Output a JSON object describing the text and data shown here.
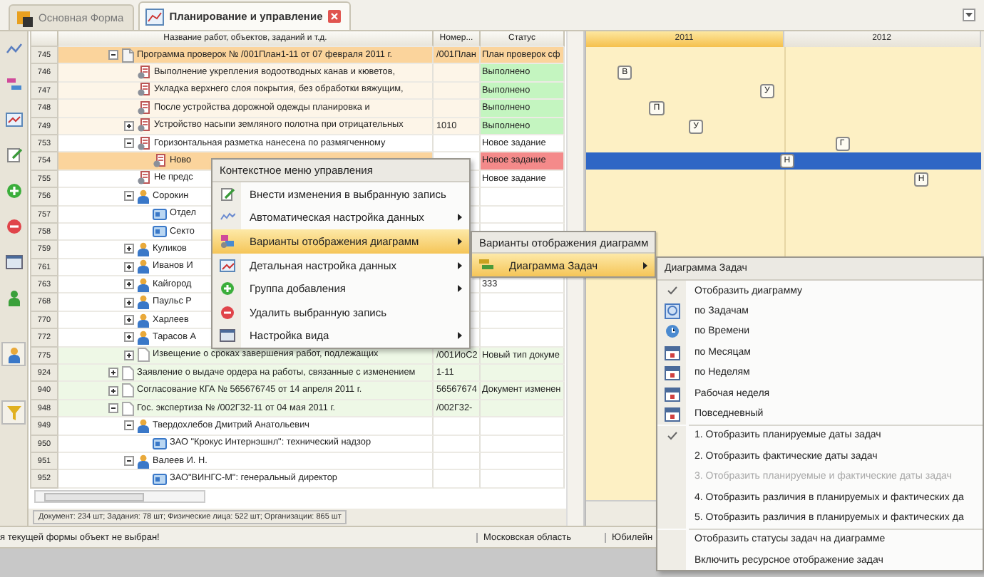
{
  "tabs": [
    {
      "label": "Основная Форма",
      "selected": false,
      "closable": false
    },
    {
      "label": "Планирование и управление",
      "selected": true,
      "closable": true
    }
  ],
  "grid": {
    "columns": [
      "Название работ, объектов, заданий и т.д.",
      "Номер...",
      "Статус"
    ],
    "rows": [
      {
        "row_number": "745",
        "kind": "program",
        "text": "Программа проверок № /001План1-11 от 07 февраля 2011 г.",
        "number": "/001План",
        "status": {
          "text": "План проверок сф",
          "color": "#fbd49c"
        },
        "color": "#fbd49c",
        "selected": false,
        "expanded": true,
        "children": [
          {
            "row_number": "746",
            "kind": "task",
            "text": "Выполнение укрепления водоотводных канав и кюветов,",
            "status": {
              "text": "Выполнено",
              "color": "#c4f5c0"
            },
            "color": "#fdf5e8",
            "selected": false,
            "gantt_label": "В"
          },
          {
            "row_number": "747",
            "kind": "task",
            "text": "Укладка верхнего слоя покрытия, без обработки вяжущим,",
            "status": {
              "text": "Выполнено",
              "color": "#c4f5c0"
            },
            "color": "#fdf5e8",
            "selected": false,
            "gantt_label": "У"
          },
          {
            "row_number": "748",
            "kind": "task",
            "text": "После устройства дорожной одежды планировка и",
            "status": {
              "text": "Выполнено",
              "color": "#c4f5c0"
            },
            "color": "#fdf5e8",
            "selected": false,
            "gantt_label": "П"
          },
          {
            "row_number": "749",
            "kind": "task",
            "text": "Устройство насыпи земляного полотна при отрицательных",
            "number": "1010",
            "status": {
              "text": "Выполнено",
              "color": "#c4f5c0"
            },
            "color": "#fdf5e8",
            "selected": false,
            "expanded": false,
            "gantt_label": "У"
          },
          {
            "row_number": "753",
            "kind": "task",
            "text": "Горизонтальная разметка нанесена по размягченному",
            "status": {
              "text": "Новое задание",
              "color": "#ffffff"
            },
            "color": "#ffffff",
            "selected": false,
            "expanded": true,
            "gantt_label": "Г",
            "children": [
              {
                "row_number": "754",
                "kind": "task",
                "text": "Ново",
                "status": {
                  "text": "Новое задание",
                  "color": "#f48a8a"
                },
                "color": "#ffffff",
                "selected": true,
                "gantt_label": "Н"
              }
            ]
          },
          {
            "row_number": "755",
            "kind": "task",
            "text": "Не предс",
            "status": {
              "text": "Новое задание",
              "color": "#ffffff"
            },
            "color": "#ffffff",
            "selected": false,
            "gantt_label": "Н"
          },
          {
            "row_number": "756",
            "kind": "person",
            "text": "Сорокин",
            "color": "#ffffff",
            "selected": false,
            "expanded": true,
            "children": [
              {
                "row_number": "757",
                "kind": "org",
                "text": "Отдел",
                "color": "#ffffff",
                "selected": false
              },
              {
                "row_number": "758",
                "kind": "org",
                "text": "Секто",
                "color": "#ffffff",
                "selected": false
              }
            ]
          },
          {
            "row_number": "759",
            "kind": "person",
            "text": "Куликов",
            "color": "#ffffff",
            "selected": false,
            "expanded": false
          },
          {
            "row_number": "761",
            "kind": "person",
            "text": "Иванов И",
            "color": "#ffffff",
            "selected": false,
            "expanded": false
          },
          {
            "row_number": "763",
            "kind": "person",
            "text": "Кайгород",
            "status": {
              "text": "333",
              "color": "#ffffff"
            },
            "color": "#ffffff",
            "selected": false,
            "expanded": false
          },
          {
            "row_number": "768",
            "kind": "person",
            "text": "Паульс Р",
            "color": "#ffffff",
            "selected": false,
            "expanded": false
          },
          {
            "row_number": "770",
            "kind": "person",
            "text": "Харлеев",
            "color": "#ffffff",
            "selected": false,
            "expanded": false
          },
          {
            "row_number": "772",
            "kind": "person",
            "text": "Тарасов А",
            "color": "#ffffff",
            "selected": false,
            "expanded": false
          },
          {
            "row_number": "775",
            "kind": "document",
            "text": "Извещение о сроках завершения работ, подлежащих",
            "number": "/001ИоС2",
            "status": {
              "text": "Новый тип докуме",
              "color": "#eef8e6"
            },
            "color": "#eef8e6",
            "selected": false,
            "expanded": false
          }
        ]
      },
      {
        "row_number": "924",
        "kind": "document",
        "text": "Заявление о выдаче ордера на работы, связанные с изменением",
        "number": "1-11",
        "color": "#eef8e6",
        "selected": false,
        "expanded": false
      },
      {
        "row_number": "940",
        "kind": "document",
        "text": "Согласование КГА № 565676745 от 14 апреля 2011 г.",
        "number": "56567674",
        "status": {
          "text": "Документ изменен",
          "color": "#eef8e6"
        },
        "color": "#eef8e6",
        "selected": false,
        "expanded": false
      },
      {
        "row_number": "948",
        "kind": "document",
        "text": "Гос. экспертиза № /002Г32-11 от 04 мая 2011 г.",
        "number": "/002Г32-",
        "color": "#eef8e6",
        "selected": false,
        "expanded": true,
        "children": [
          {
            "row_number": "949",
            "kind": "person",
            "text": "Твердохлебов Дмитрий Анатольевич",
            "color": "#ffffff",
            "selected": false,
            "expanded": true,
            "children": [
              {
                "row_number": "950",
                "kind": "org",
                "text": "ЗАО \"Крокус Интернэшнл\": технический надзор",
                "color": "#ffffff",
                "selected": false
              }
            ]
          },
          {
            "row_number": "951",
            "kind": "person",
            "text": "Валеев И. Н.",
            "color": "#ffffff",
            "selected": false,
            "expanded": true,
            "children": [
              {
                "row_number": "952",
                "kind": "org",
                "text": "ЗАО\"ВИНГС-М\": генеральный директор",
                "color": "#ffffff",
                "selected": false
              }
            ]
          }
        ]
      }
    ]
  },
  "gantt": {
    "years": [
      {
        "label": "2011",
        "selected": true
      },
      {
        "label": "2012",
        "selected": false
      }
    ]
  },
  "summary": "Документ: 234 шт; Задания: 78 шт; Физические лица: 522 шт; Организации: 865 шт",
  "status_bar": [
    "я текущей формы объект не выбран!",
    "Московская область",
    "Юбилейн"
  ],
  "context_menu": {
    "title": "Контекстное меню управления",
    "items": [
      {
        "label": "Внести изменения в выбранную запись",
        "submenu": false,
        "selected": false
      },
      {
        "label": "Автоматическая настройка данных",
        "submenu": true,
        "selected": false
      },
      {
        "label": "Варианты отображения диаграмм",
        "submenu": true,
        "selected": true
      },
      {
        "label": "Детальная настройка данных",
        "submenu": true,
        "selected": false
      },
      {
        "label": "Группа добавления",
        "submenu": true,
        "selected": false
      },
      {
        "label": "Удалить выбранную запись",
        "submenu": false,
        "selected": false
      },
      {
        "label": "Настройка вида",
        "submenu": true,
        "selected": false
      }
    ]
  },
  "submenu": {
    "title": "Варианты отображения диаграмм",
    "items": [
      {
        "label": "Диаграмма Задач",
        "submenu": true,
        "selected": true
      }
    ]
  },
  "chart_menu": {
    "title": "Диаграмма Задач",
    "groups": [
      [
        {
          "kind": "toggle",
          "label": "Отобразить диаграмму",
          "checked": true,
          "disabled": false
        },
        {
          "kind": "view",
          "label": "по Задачам"
        },
        {
          "kind": "view",
          "label": "по Времени"
        },
        {
          "kind": "view",
          "label": "по Месяцам"
        },
        {
          "kind": "view",
          "label": "по Неделям"
        },
        {
          "kind": "view",
          "label": "Рабочая неделя"
        },
        {
          "kind": "view",
          "label": "Повседневный"
        }
      ],
      [
        {
          "kind": "toggle",
          "label": "1. Отобразить планируемые даты задач",
          "checked": true,
          "disabled": false
        },
        {
          "kind": "toggle",
          "label": "2. Отобразить фактические даты задач",
          "checked": false,
          "disabled": false
        },
        {
          "kind": "toggle",
          "label": "3. Отобразить планируемые и фактические даты задач",
          "checked": false,
          "disabled": true
        },
        {
          "kind": "toggle",
          "label": "4. Отобразить различия в планируемых и фактических да",
          "checked": false,
          "disabled": false
        },
        {
          "kind": "toggle",
          "label": "5. Отобразить различия в планируемых и фактических да",
          "checked": false,
          "disabled": false
        }
      ],
      [
        {
          "kind": "toggle",
          "label": "Отобразить статусы задач на диаграмме",
          "checked": false,
          "disabled": false
        },
        {
          "kind": "toggle",
          "label": "Включить ресурсное отображение задач",
          "checked": false,
          "disabled": false
        }
      ]
    ]
  }
}
